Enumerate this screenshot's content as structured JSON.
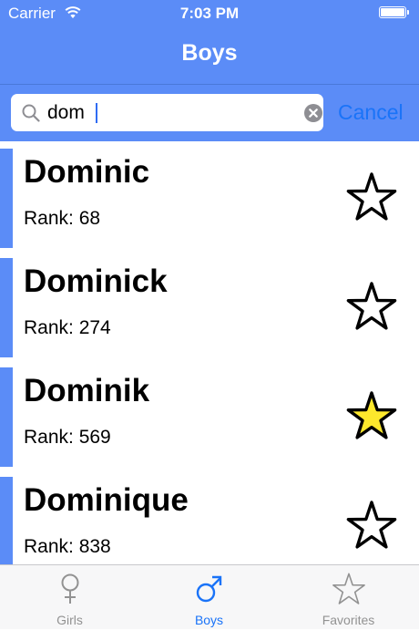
{
  "status": {
    "carrier": "Carrier",
    "time": "7:03 PM"
  },
  "nav": {
    "title": "Boys"
  },
  "search": {
    "value": "dom",
    "cancel_label": "Cancel"
  },
  "rows": [
    {
      "name": "Dominic",
      "rank": "Rank: 68",
      "favorite": false
    },
    {
      "name": "Dominick",
      "rank": "Rank: 274",
      "favorite": false
    },
    {
      "name": "Dominik",
      "rank": "Rank: 569",
      "favorite": true
    },
    {
      "name": "Dominique",
      "rank": "Rank: 838",
      "favorite": false
    }
  ],
  "tabs": [
    {
      "label": "Girls",
      "icon": "female-icon",
      "active": false
    },
    {
      "label": "Boys",
      "icon": "male-icon",
      "active": true
    },
    {
      "label": "Favorites",
      "icon": "star-icon",
      "active": false
    }
  ],
  "colors": {
    "accent": "#5b8cf7",
    "tint": "#1a73f8",
    "favorite_fill": "#fde82c"
  }
}
